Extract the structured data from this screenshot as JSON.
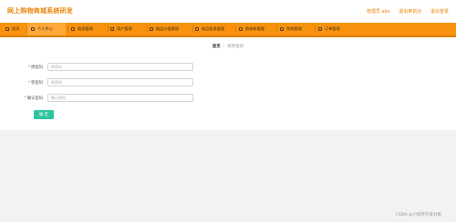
{
  "app": {
    "title": "网上购物商城系统研发"
  },
  "top_links": {
    "user": "管理员 abo",
    "back_home": "退出到前台",
    "logout": "退出登录"
  },
  "nav": [
    {
      "label": "首页"
    },
    {
      "label": "个人中心",
      "active": true
    },
    {
      "label": "商家管理"
    },
    {
      "label": "用户管理"
    },
    {
      "label": "商品分类管理"
    },
    {
      "label": "商品信息管理"
    },
    {
      "label": "购物车管理"
    },
    {
      "label": "系统管理"
    },
    {
      "label": "订单管理"
    }
  ],
  "breadcrumb": {
    "home": "首页",
    "separator": "/",
    "current": "修改密码"
  },
  "form": {
    "fields": [
      {
        "label": "原密码",
        "placeholder": "原密码",
        "value": ""
      },
      {
        "label": "新密码",
        "placeholder": "新密码",
        "value": ""
      },
      {
        "label": "确认密码",
        "placeholder": "确认密码",
        "value": ""
      }
    ],
    "submit_label": "确 定"
  },
  "watermark": "CSDN @小程序开发对象",
  "colors": {
    "accent": "#f8920e",
    "brand_text": "#e8860b",
    "submit": "#2ec4a0"
  }
}
